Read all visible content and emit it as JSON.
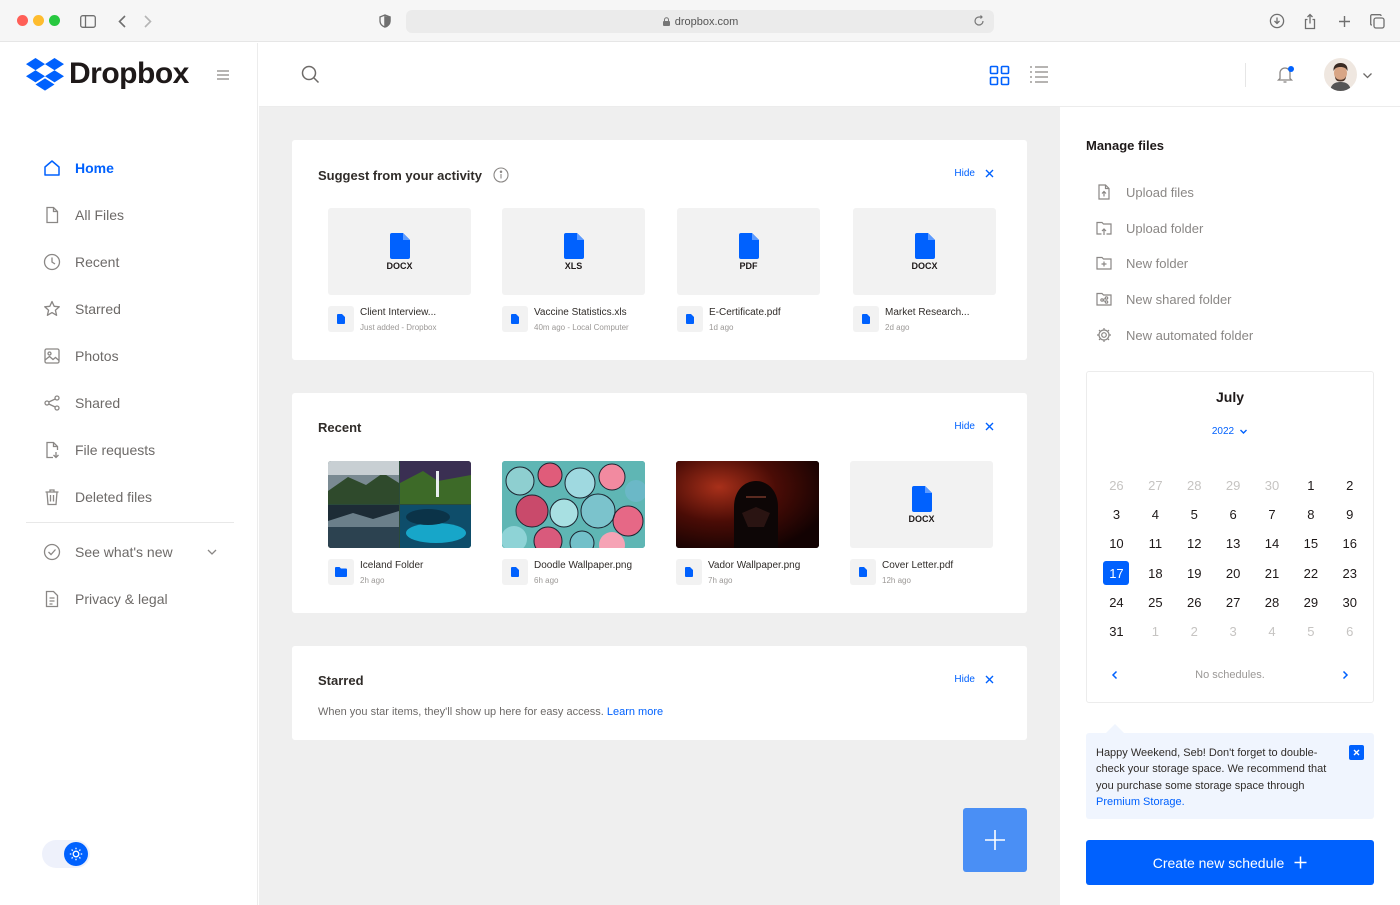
{
  "browser": {
    "url": "dropbox.com"
  },
  "brand": {
    "name": "Dropbox",
    "color": "#0061fe"
  },
  "sidebar": {
    "items": [
      {
        "label": "Home",
        "icon": "home-icon",
        "active": true
      },
      {
        "label": "All Files",
        "icon": "file-icon"
      },
      {
        "label": "Recent",
        "icon": "clock-icon"
      },
      {
        "label": "Starred",
        "icon": "star-icon"
      },
      {
        "label": "Photos",
        "icon": "image-icon"
      },
      {
        "label": "Shared",
        "icon": "share-icon"
      },
      {
        "label": "File requests",
        "icon": "file-request-icon"
      },
      {
        "label": "Deleted files",
        "icon": "trash-icon"
      }
    ],
    "secondary": [
      {
        "label": "See what's new",
        "icon": "check-circle-icon"
      },
      {
        "label": "Privacy & legal",
        "icon": "document-icon"
      }
    ]
  },
  "suggest": {
    "title": "Suggest from your activity",
    "hide_label": "Hide",
    "files": [
      {
        "type": "DOCX",
        "name": "Client Interview...",
        "meta": "Just added - Dropbox"
      },
      {
        "type": "XLS",
        "name": "Vaccine Statistics.xls",
        "meta": "40m ago - Local Computer"
      },
      {
        "type": "PDF",
        "name": "E-Certificate.pdf",
        "meta": "1d ago"
      },
      {
        "type": "DOCX",
        "name": "Market Research...",
        "meta": "2d ago"
      }
    ]
  },
  "recent": {
    "title": "Recent",
    "hide_label": "Hide",
    "files": [
      {
        "thumb": "landscape-collage",
        "name": "Iceland Folder",
        "meta": "2h ago",
        "kind": "folder"
      },
      {
        "thumb": "doodle-art",
        "name": "Doodle Wallpaper.png",
        "meta": "6h ago",
        "kind": "file"
      },
      {
        "thumb": "vador-dark",
        "name": "Vador Wallpaper.png",
        "meta": "7h ago",
        "kind": "file"
      },
      {
        "type": "DOCX",
        "name": "Cover Letter.pdf",
        "meta": "12h ago",
        "kind": "file"
      }
    ]
  },
  "starred": {
    "title": "Starred",
    "hide_label": "Hide",
    "text": "When you star items, they'll show up here for easy access.",
    "link": "Learn more"
  },
  "manage": {
    "title": "Manage files",
    "items": [
      {
        "label": "Upload files",
        "icon": "upload-file-icon"
      },
      {
        "label": "Upload folder",
        "icon": "upload-folder-icon"
      },
      {
        "label": "New folder",
        "icon": "new-folder-icon"
      },
      {
        "label": "New shared folder",
        "icon": "shared-folder-icon"
      },
      {
        "label": "New automated folder",
        "icon": "gear-icon"
      }
    ]
  },
  "calendar": {
    "month": "July",
    "year": "2022",
    "selected_day": "17",
    "days": [
      {
        "d": "26",
        "m": true
      },
      {
        "d": "27",
        "m": true
      },
      {
        "d": "28",
        "m": true
      },
      {
        "d": "29",
        "m": true
      },
      {
        "d": "30",
        "m": true
      },
      {
        "d": "1"
      },
      {
        "d": "2"
      },
      {
        "d": "3"
      },
      {
        "d": "4"
      },
      {
        "d": "5"
      },
      {
        "d": "6"
      },
      {
        "d": "7"
      },
      {
        "d": "8"
      },
      {
        "d": "9"
      },
      {
        "d": "10"
      },
      {
        "d": "11"
      },
      {
        "d": "12"
      },
      {
        "d": "13"
      },
      {
        "d": "14"
      },
      {
        "d": "15"
      },
      {
        "d": "16"
      },
      {
        "d": "17"
      },
      {
        "d": "18"
      },
      {
        "d": "19"
      },
      {
        "d": "20"
      },
      {
        "d": "21"
      },
      {
        "d": "22"
      },
      {
        "d": "23"
      },
      {
        "d": "24"
      },
      {
        "d": "25"
      },
      {
        "d": "26"
      },
      {
        "d": "27"
      },
      {
        "d": "28"
      },
      {
        "d": "29"
      },
      {
        "d": "30"
      },
      {
        "d": "31"
      },
      {
        "d": "1",
        "m": true
      },
      {
        "d": "2",
        "m": true
      },
      {
        "d": "3",
        "m": true
      },
      {
        "d": "4",
        "m": true
      },
      {
        "d": "5",
        "m": true
      },
      {
        "d": "6",
        "m": true
      }
    ],
    "empty_text": "No schedules."
  },
  "tip": {
    "text": "Happy Weekend, Seb! Don't forget to double-check your storage space. We recommend that you purchase some storage space through",
    "link": "Premium Storage."
  },
  "create_button": "Create new schedule"
}
